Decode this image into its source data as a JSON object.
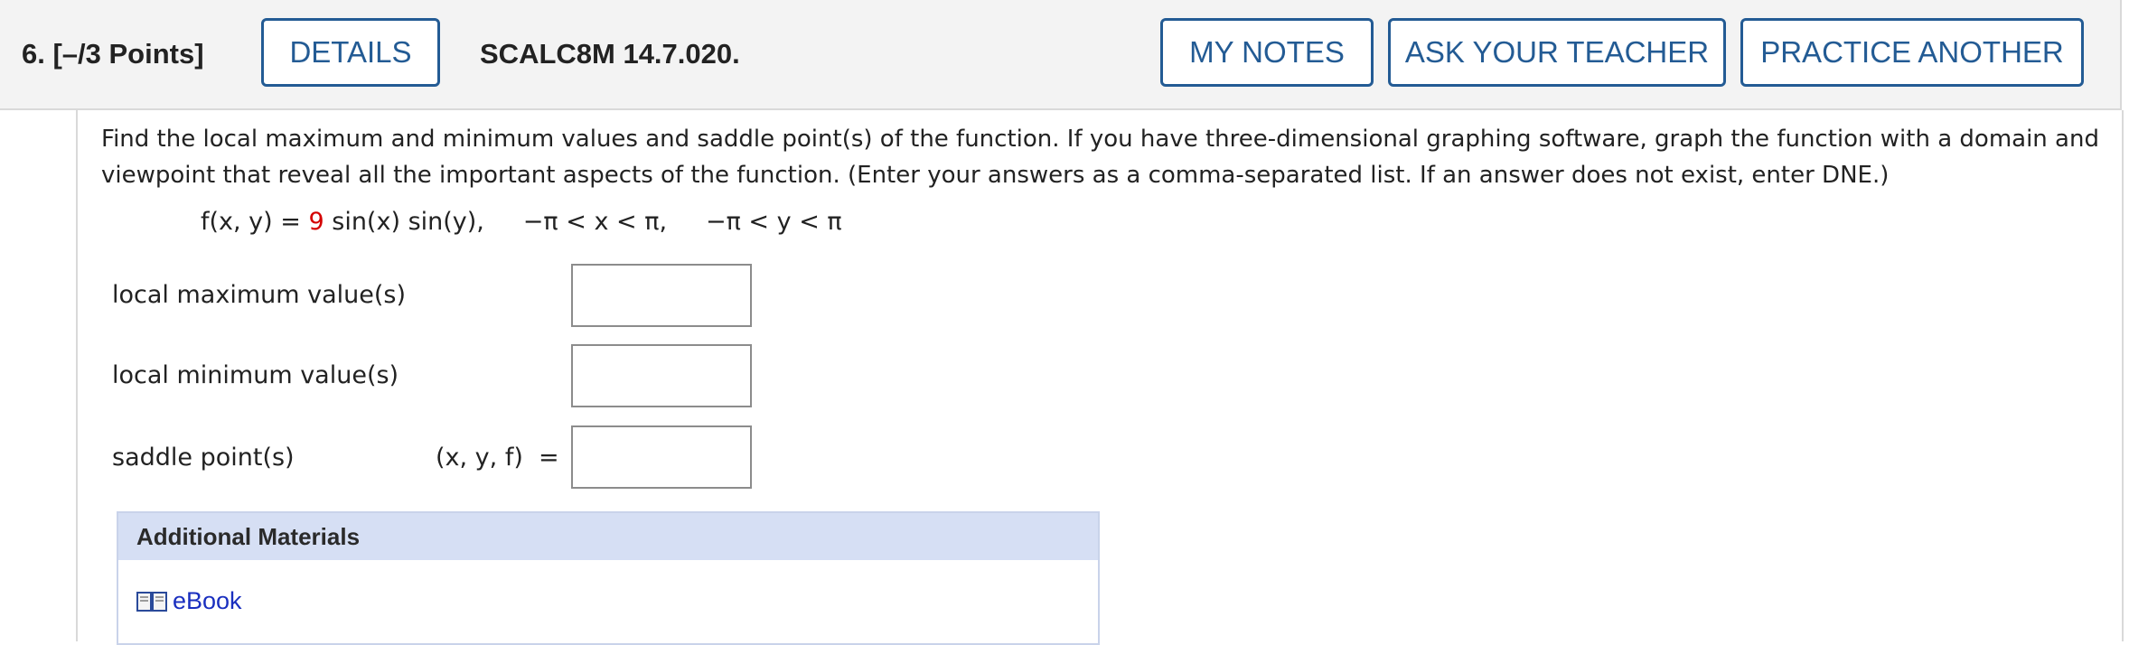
{
  "header": {
    "question_label": "6.  [–/3 Points]",
    "details_label": "DETAILS",
    "problem_code": "SCALC8M 14.7.020.",
    "my_notes_label": "MY NOTES",
    "ask_teacher_label": "ASK YOUR TEACHER",
    "practice_label": "PRACTICE ANOTHER"
  },
  "question": {
    "prompt": "Find the local maximum and minimum values and saddle point(s) of the function. If you have three-dimensional graphing software, graph the function with a domain and viewpoint that reveal all the important aspects of the function. (Enter your answers as a comma-separated list. If an answer does not exist, enter DNE.)",
    "formula_lhs": "f(x, y) = ",
    "formula_coef": "9",
    "formula_rhs": " sin(x) sin(y),     −π < x < π,     −π < y < π",
    "accent_color": "#d40000"
  },
  "answers": {
    "local_max_label": "local maximum value(s)",
    "local_min_label": "local minimum value(s)",
    "saddle_label": "saddle point(s)",
    "saddle_prefix": "(x, y, f)  =",
    "local_max_value": "",
    "local_min_value": "",
    "saddle_value": ""
  },
  "additional_materials": {
    "title": "Additional Materials",
    "link_label": "eBook",
    "link_icon": "book-icon"
  },
  "colors": {
    "button_border": "#235b94",
    "link": "#1a2fbf",
    "materials_header_bg": "#d6dff4"
  }
}
